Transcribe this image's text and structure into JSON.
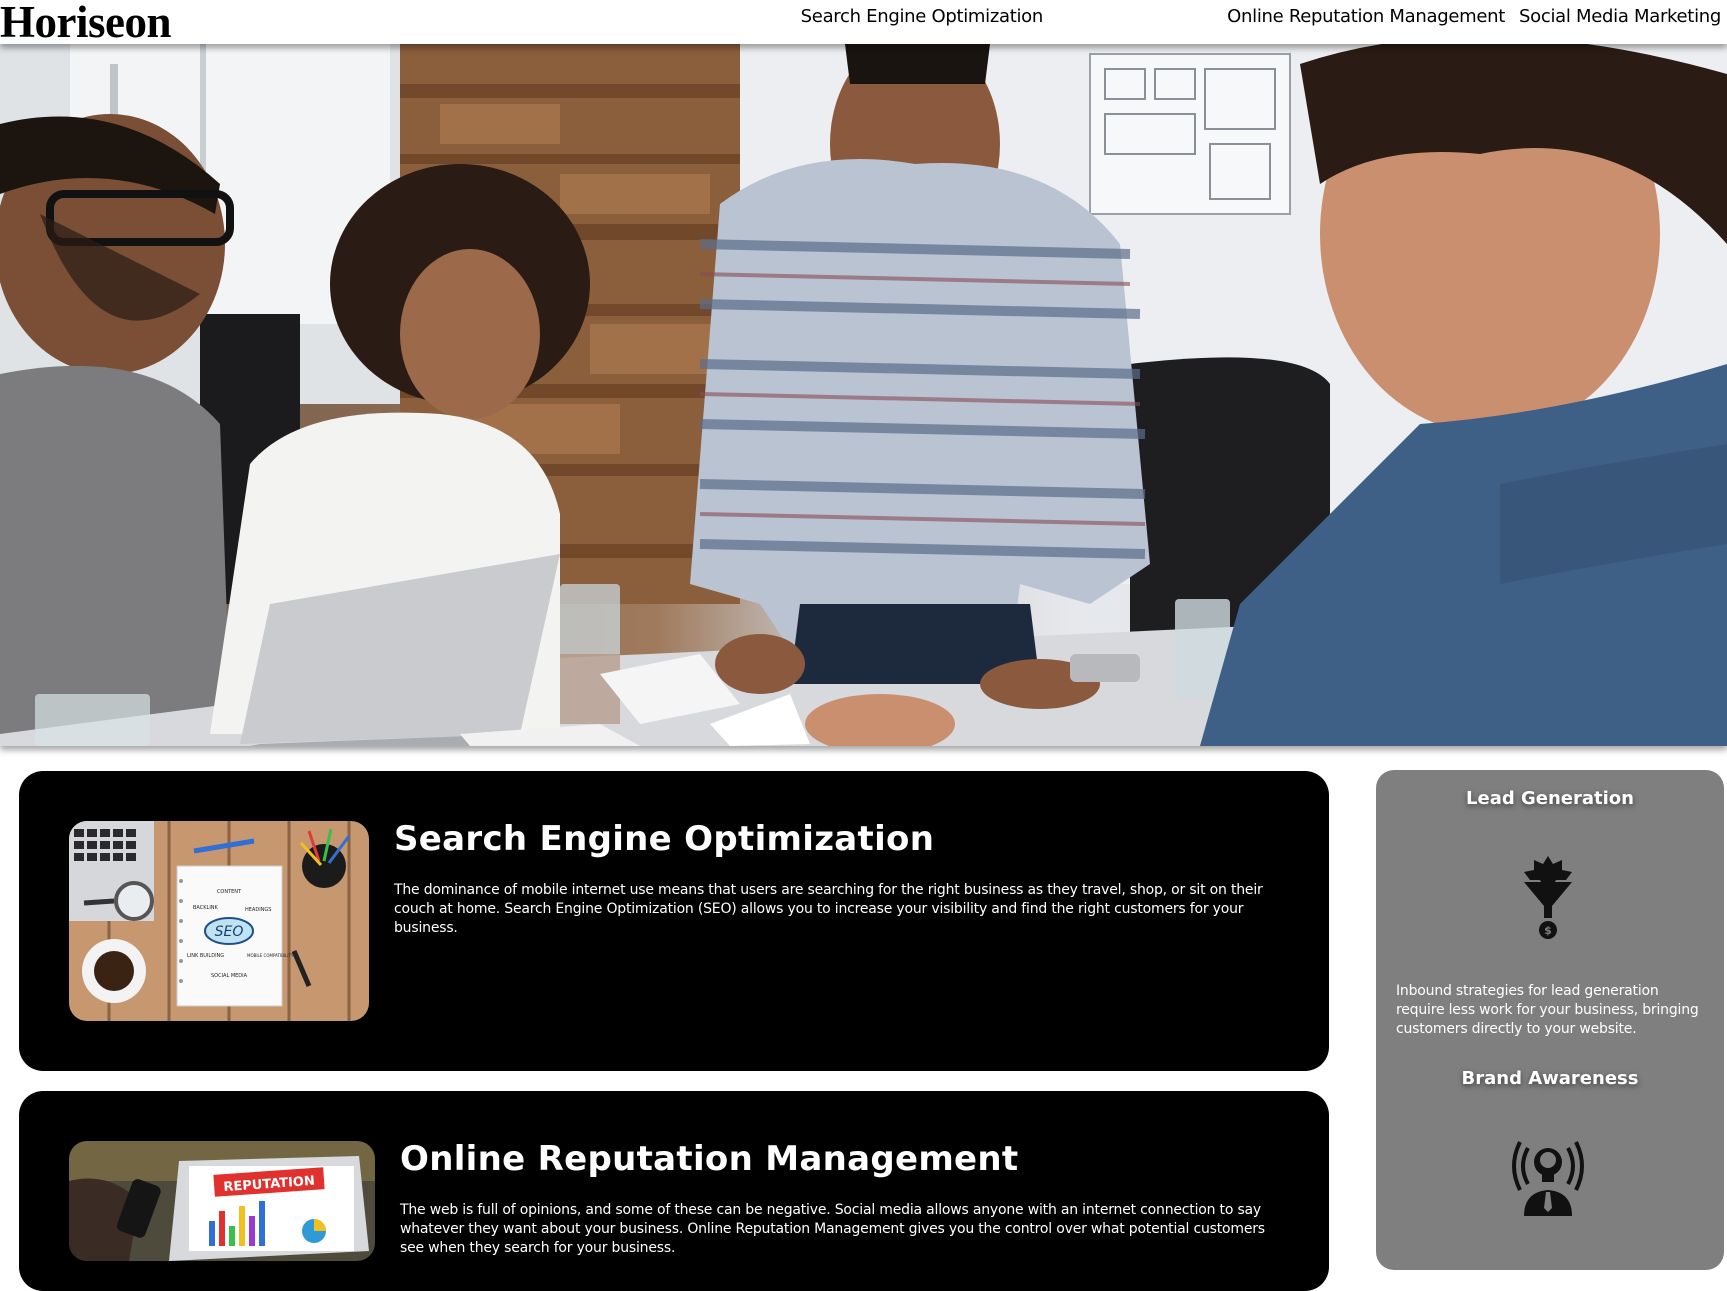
{
  "header": {
    "logo": "Horiseon",
    "nav": [
      {
        "label": "Search Engine Optimization"
      },
      {
        "label": "Online Reputation Management"
      },
      {
        "label": "Social Media Marketing"
      }
    ]
  },
  "hero": {
    "image": "team-meeting-photo"
  },
  "content": [
    {
      "title": "Search Engine Optimization",
      "text": "The dominance of mobile internet use means that users are searching for the right business as they travel, shop, or sit on their couch at home. Search Engine Optimization (SEO) allows you to increase your visibility and find the right customers for your business.",
      "image": "seo-notebook-image",
      "image_labels": [
        "SEO",
        "CONTENT",
        "BACKLINK",
        "HEADINGS",
        "LINK BUILDING",
        "MOBILE COMPATIBILITY",
        "SOCIAL MEDIA"
      ]
    },
    {
      "title": "Online Reputation Management",
      "text": "The web is full of opinions, and some of these can be negative. Social media allows anyone with an internet connection to say whatever they want about your business. Online Reputation Management gives you the control over what potential customers see when they search for your business.",
      "image": "reputation-laptop-image",
      "image_labels": [
        "REPUTATION"
      ]
    }
  ],
  "benefits": [
    {
      "title": "Lead Generation",
      "icon": "lead-generation-icon",
      "text": "Inbound strategies for lead generation require less work for your business, bringing customers directly to your website."
    },
    {
      "title": "Brand Awareness",
      "icon": "brand-awareness-icon",
      "text": ""
    }
  ],
  "colors": {
    "card_background": "#000000",
    "sidebar_background": "#7f7f7f",
    "header_background": "#ffffff",
    "text_light": "#ffffff"
  }
}
